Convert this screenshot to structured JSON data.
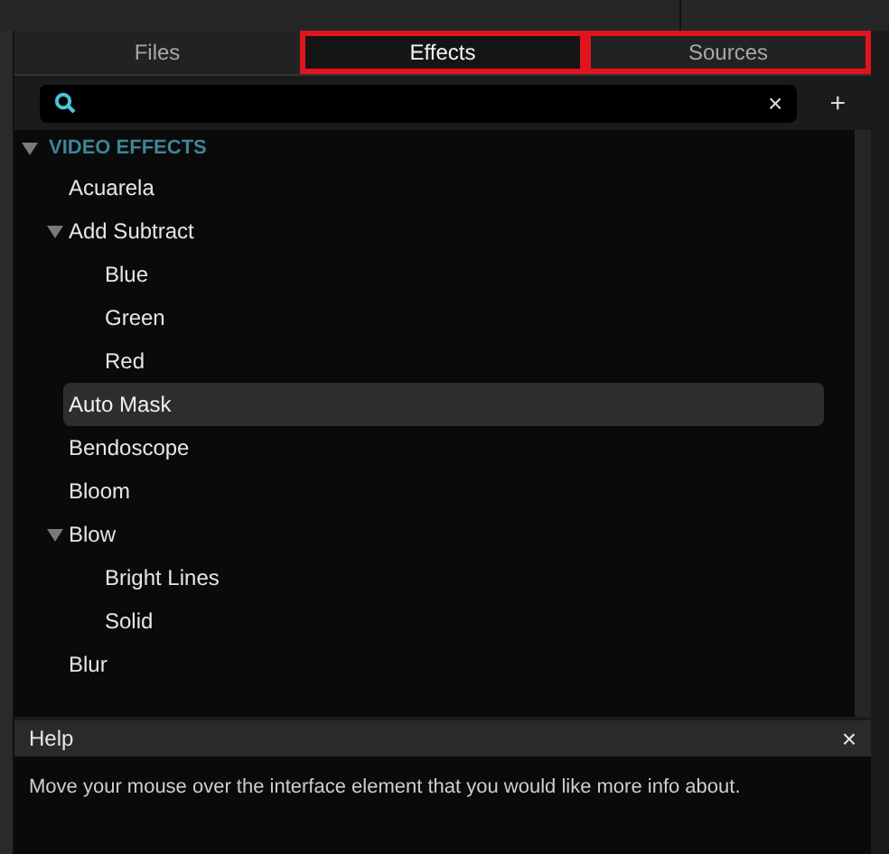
{
  "tabs": [
    {
      "label": "Files",
      "selected": false,
      "highlighted": false
    },
    {
      "label": "Effects",
      "selected": true,
      "highlighted": true
    },
    {
      "label": "Sources",
      "selected": false,
      "highlighted": true
    }
  ],
  "search": {
    "clear": "×",
    "add": "+"
  },
  "tree": {
    "label": "VIDEO EFFECTS",
    "expanded": true,
    "children": [
      {
        "label": "Acuarela",
        "selected": false
      },
      {
        "label": "Add Subtract",
        "selected": false,
        "expanded": true,
        "children": [
          {
            "label": "Blue",
            "selected": false
          },
          {
            "label": "Green",
            "selected": false
          },
          {
            "label": "Red",
            "selected": false
          }
        ]
      },
      {
        "label": "Auto Mask",
        "selected": true
      },
      {
        "label": "Bendoscope",
        "selected": false
      },
      {
        "label": "Bloom",
        "selected": false
      },
      {
        "label": "Blow",
        "selected": false,
        "expanded": true,
        "children": [
          {
            "label": "Bright Lines",
            "selected": false
          },
          {
            "label": "Solid",
            "selected": false
          }
        ]
      },
      {
        "label": "Blur",
        "selected": false
      }
    ]
  },
  "help": {
    "title": "Help",
    "close": "×",
    "text": "Move your mouse over the interface element that you would like more info about."
  }
}
